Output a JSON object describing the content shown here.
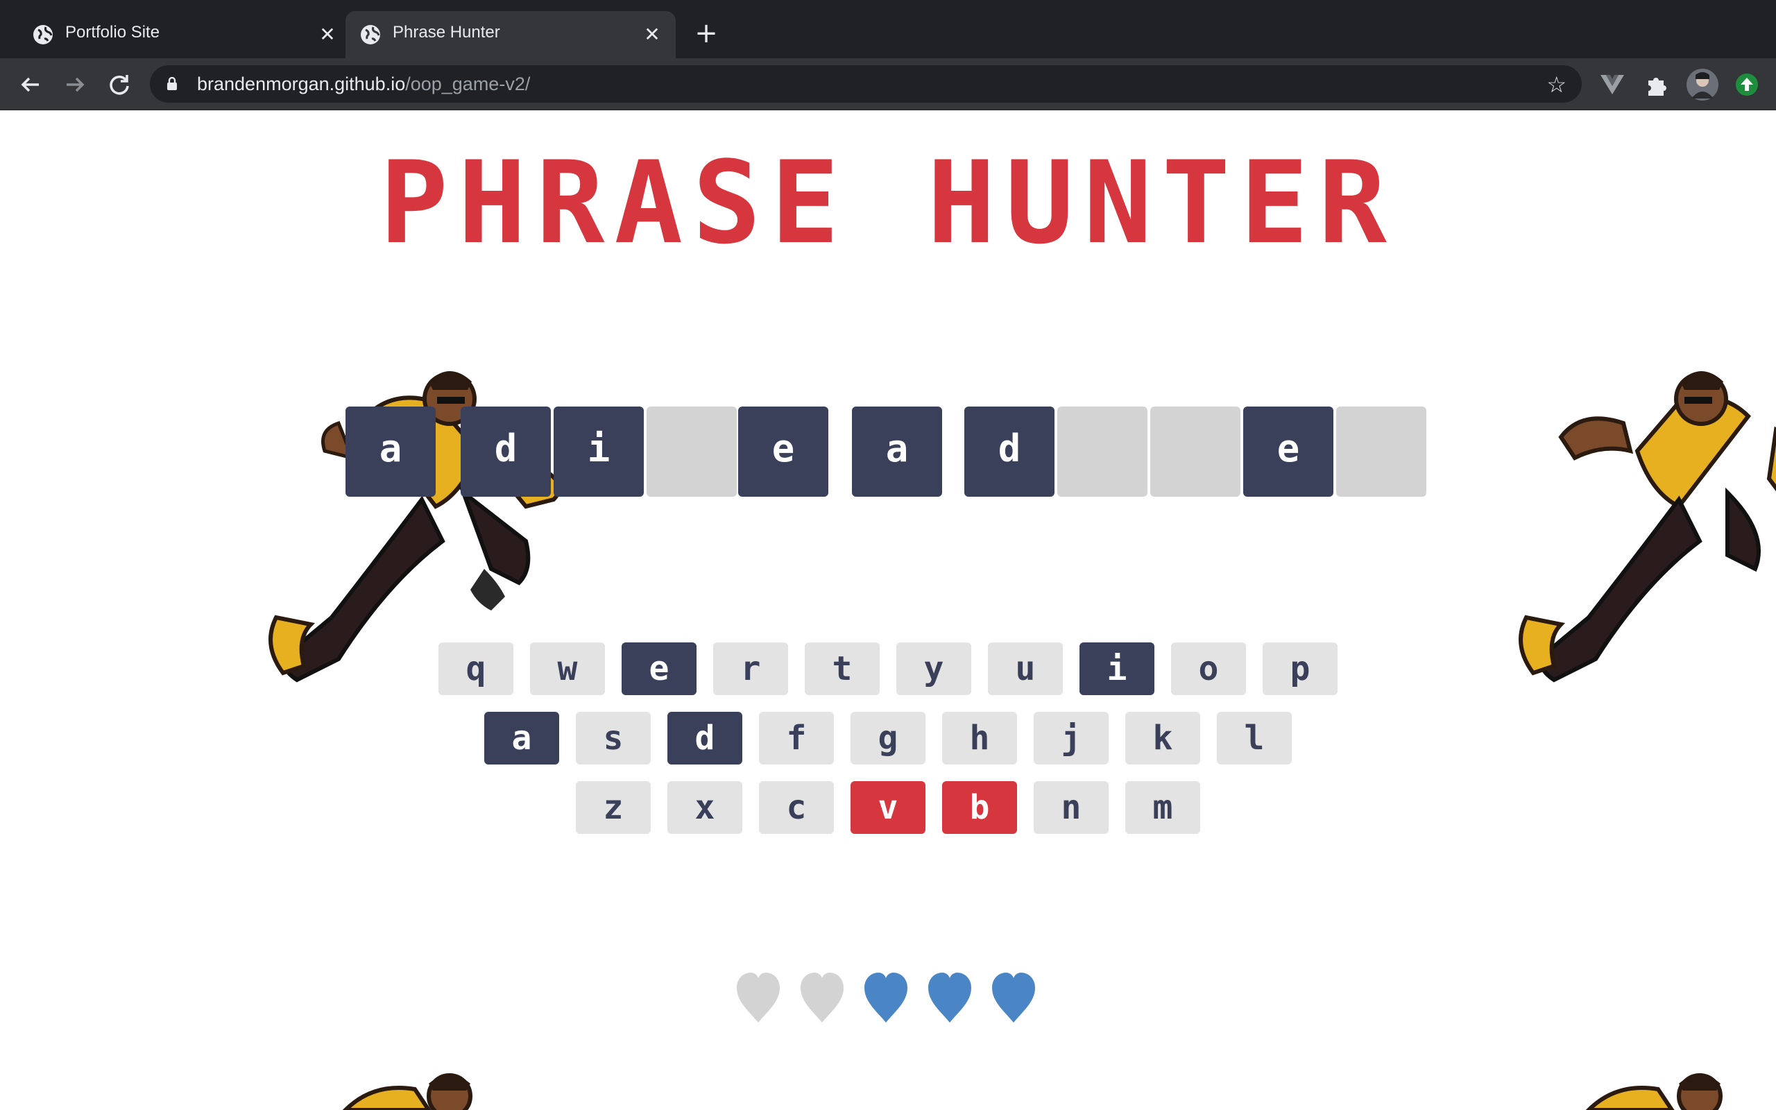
{
  "browser": {
    "tabs": [
      {
        "title": "Portfolio Site",
        "active": false
      },
      {
        "title": "Phrase Hunter",
        "active": true
      }
    ],
    "url_host": "brandenmorgan.github.io",
    "url_path": "/oop_game-v2/",
    "icons": [
      "globe-icon",
      "close-icon",
      "plus-icon",
      "back-icon",
      "forward-icon",
      "reload-icon",
      "lock-icon",
      "star-icon",
      "vue-devtools-icon",
      "extensions-icon",
      "profile-avatar",
      "update-icon"
    ]
  },
  "game": {
    "title": "PHRASE HUNTER",
    "phrase": [
      {
        "letter": "a",
        "shown": true
      },
      {
        "letter": "d",
        "shown": true
      },
      {
        "letter": "i",
        "shown": true
      },
      {
        "letter": "",
        "shown": false
      },
      {
        "letter": "e",
        "shown": true
      },
      {
        "letter": "a",
        "shown": true
      },
      {
        "letter": "d",
        "shown": true
      },
      {
        "letter": "",
        "shown": false
      },
      {
        "letter": "",
        "shown": false
      },
      {
        "letter": "e",
        "shown": true
      },
      {
        "letter": "",
        "shown": false
      }
    ],
    "keyboard": [
      [
        {
          "k": "q",
          "s": "none"
        },
        {
          "k": "w",
          "s": "none"
        },
        {
          "k": "e",
          "s": "chosen"
        },
        {
          "k": "r",
          "s": "none"
        },
        {
          "k": "t",
          "s": "none"
        },
        {
          "k": "y",
          "s": "none"
        },
        {
          "k": "u",
          "s": "none"
        },
        {
          "k": "i",
          "s": "chosen"
        },
        {
          "k": "o",
          "s": "none"
        },
        {
          "k": "p",
          "s": "none"
        }
      ],
      [
        {
          "k": "a",
          "s": "chosen"
        },
        {
          "k": "s",
          "s": "none"
        },
        {
          "k": "d",
          "s": "chosen"
        },
        {
          "k": "f",
          "s": "none"
        },
        {
          "k": "g",
          "s": "none"
        },
        {
          "k": "h",
          "s": "none"
        },
        {
          "k": "j",
          "s": "none"
        },
        {
          "k": "k",
          "s": "none"
        },
        {
          "k": "l",
          "s": "none"
        }
      ],
      [
        {
          "k": "z",
          "s": "none"
        },
        {
          "k": "x",
          "s": "none"
        },
        {
          "k": "c",
          "s": "none"
        },
        {
          "k": "v",
          "s": "wrong"
        },
        {
          "k": "b",
          "s": "wrong"
        },
        {
          "k": "n",
          "s": "none"
        },
        {
          "k": "m",
          "s": "none"
        }
      ]
    ],
    "lives": {
      "total": 5,
      "lost": 2
    },
    "colors": {
      "title_red": "#d6373f",
      "tile_dark": "#3a3f5a",
      "tile_hidden": "#d3d3d3",
      "key_default": "#e3e3e3",
      "key_wrong": "#d6373f",
      "heart_live": "#4a86c5",
      "heart_lost": "#d3d3d3"
    }
  }
}
